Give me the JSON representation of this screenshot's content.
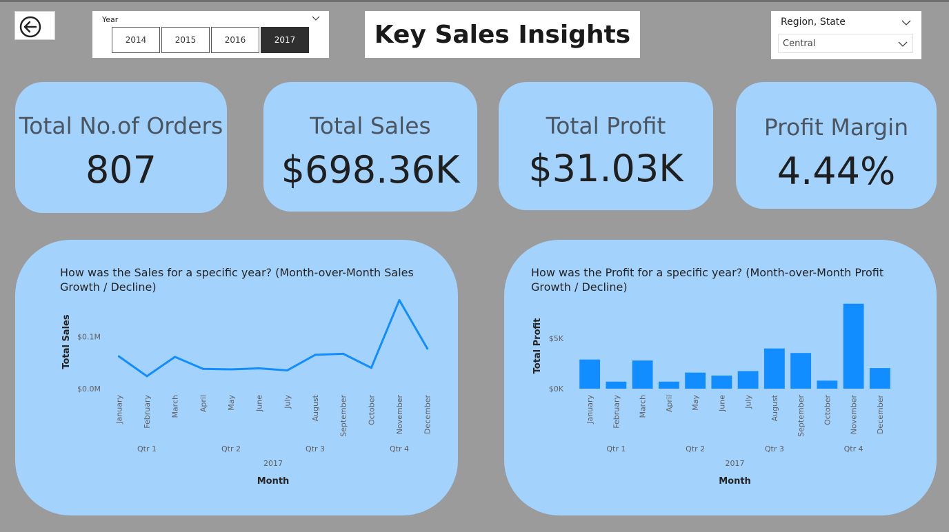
{
  "header": {
    "title": "Key Sales Insights",
    "year_slicer": {
      "title": "Year",
      "options": [
        "2014",
        "2015",
        "2016",
        "2017"
      ],
      "selected": "2017"
    },
    "region_slicer": {
      "title": "Region, State",
      "selected": "Central"
    }
  },
  "kpis": [
    {
      "label": "Total No.of Orders",
      "value": "807"
    },
    {
      "label": "Total Sales",
      "value": "$698.36K"
    },
    {
      "label": "Total Profit",
      "value": "$31.03K"
    },
    {
      "label": "Profit Margin",
      "value": "4.44%"
    }
  ],
  "colors": {
    "background": "#9b9b9b",
    "card": "#a3d2fd",
    "series": "#118dff",
    "active_button": "#2f2f2f"
  },
  "chart_data": [
    {
      "type": "line",
      "title": "How was the Sales for a specific year? (Month-over-Month Sales Growth / Decline)",
      "xlabel": "Month",
      "ylabel": "Total Sales",
      "year_label": "2017",
      "quarters": [
        "Qtr 1",
        "Qtr 2",
        "Qtr 3",
        "Qtr 4"
      ],
      "categories": [
        "January",
        "February",
        "March",
        "April",
        "May",
        "June",
        "July",
        "August",
        "September",
        "October",
        "November",
        "December"
      ],
      "values": [
        62000,
        24000,
        61000,
        38000,
        37000,
        39000,
        35000,
        65000,
        67000,
        40000,
        170000,
        77000
      ],
      "yticks": [
        {
          "v": 0,
          "label": "$0.0M"
        },
        {
          "v": 100000,
          "label": "$0.1M"
        }
      ],
      "ylim": [
        0,
        180000
      ],
      "grid": false
    },
    {
      "type": "bar",
      "title": "How was the Profit for a specific year? (Month-over-Month Profit Growth / Decline)",
      "xlabel": "Month",
      "ylabel": "Total Profit",
      "year_label": "2017",
      "quarters": [
        "Qtr 1",
        "Qtr 2",
        "Qtr 3",
        "Qtr 4"
      ],
      "categories": [
        "January",
        "February",
        "March",
        "April",
        "May",
        "June",
        "July",
        "August",
        "September",
        "October",
        "November",
        "December"
      ],
      "values": [
        2900,
        700,
        2800,
        700,
        1600,
        1300,
        1750,
        4000,
        3550,
        800,
        8450,
        2050
      ],
      "yticks": [
        {
          "v": 0,
          "label": "$0K"
        },
        {
          "v": 5000,
          "label": "$5K"
        }
      ],
      "ylim": [
        0,
        8500
      ],
      "grid": false
    }
  ]
}
